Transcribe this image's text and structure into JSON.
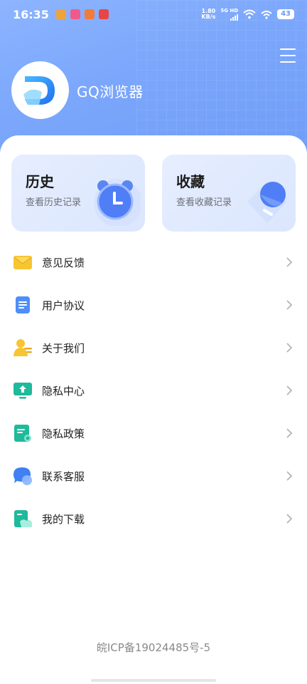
{
  "status_bar": {
    "time": "16:35",
    "net_speed_value": "1.80",
    "net_speed_unit": "KB/s",
    "signal_label_top": "5G HD",
    "battery": "43"
  },
  "header": {
    "app_name": "GQ浏览器"
  },
  "cards": [
    {
      "title": "历史",
      "subtitle": "查看历史记录"
    },
    {
      "title": "收藏",
      "subtitle": "查看收藏记录"
    }
  ],
  "menu": [
    {
      "label": "意见反馈",
      "icon": "envelope-icon"
    },
    {
      "label": "用户协议",
      "icon": "document-icon"
    },
    {
      "label": "关于我们",
      "icon": "person-icon"
    },
    {
      "label": "隐私中心",
      "icon": "monitor-upload-icon"
    },
    {
      "label": "隐私政策",
      "icon": "policy-document-icon"
    },
    {
      "label": "联系客服",
      "icon": "chat-bubble-icon"
    },
    {
      "label": "我的下载",
      "icon": "download-folder-icon"
    }
  ],
  "footer": {
    "icp": "皖ICP备19024485号-5"
  },
  "colors": {
    "hero_blue": "#7aa6fb",
    "accent_blue": "#4f7ef6",
    "card_bg": "#e3ebfe"
  }
}
